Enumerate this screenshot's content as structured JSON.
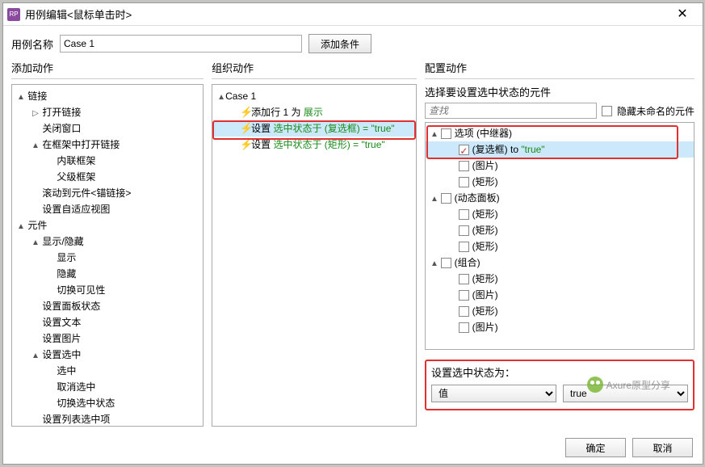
{
  "titlebar": {
    "title": "用例编辑<鼠标单击时>"
  },
  "top": {
    "label": "用例名称",
    "value": "Case 1",
    "addCondition": "添加条件"
  },
  "headers": {
    "left": "添加动作",
    "mid": "组织动作",
    "right": "配置动作"
  },
  "leftTree": [
    {
      "lvl": 0,
      "exp": "▲",
      "text": "链接"
    },
    {
      "lvl": 1,
      "exp": "▷",
      "text": "打开链接"
    },
    {
      "lvl": 1,
      "exp": "",
      "text": "关闭窗口"
    },
    {
      "lvl": 1,
      "exp": "▲",
      "text": "在框架中打开链接"
    },
    {
      "lvl": 2,
      "exp": "",
      "text": "内联框架"
    },
    {
      "lvl": 2,
      "exp": "",
      "text": "父级框架"
    },
    {
      "lvl": 1,
      "exp": "",
      "text": "滚动到元件<锚链接>"
    },
    {
      "lvl": 1,
      "exp": "",
      "text": "设置自适应视图"
    },
    {
      "lvl": 0,
      "exp": "▲",
      "text": "元件"
    },
    {
      "lvl": 1,
      "exp": "▲",
      "text": "显示/隐藏"
    },
    {
      "lvl": 2,
      "exp": "",
      "text": "显示"
    },
    {
      "lvl": 2,
      "exp": "",
      "text": "隐藏"
    },
    {
      "lvl": 2,
      "exp": "",
      "text": "切换可见性"
    },
    {
      "lvl": 1,
      "exp": "",
      "text": "设置面板状态"
    },
    {
      "lvl": 1,
      "exp": "",
      "text": "设置文本"
    },
    {
      "lvl": 1,
      "exp": "",
      "text": "设置图片"
    },
    {
      "lvl": 1,
      "exp": "▲",
      "text": "设置选中"
    },
    {
      "lvl": 2,
      "exp": "",
      "text": "选中"
    },
    {
      "lvl": 2,
      "exp": "",
      "text": "取消选中"
    },
    {
      "lvl": 2,
      "exp": "",
      "text": "切换选中状态"
    },
    {
      "lvl": 1,
      "exp": "",
      "text": "设置列表选中项"
    }
  ],
  "midTree": [
    {
      "lvl": 0,
      "exp": "▲",
      "lightning": false,
      "pre": "Case 1",
      "green": ""
    },
    {
      "lvl": 1,
      "exp": "",
      "lightning": true,
      "pre": "添加行 1 为 ",
      "green": "展示"
    },
    {
      "lvl": 1,
      "exp": "",
      "lightning": true,
      "pre": "设置 ",
      "green": "选中状态于 (复选框) = \"true\"",
      "sel": true
    },
    {
      "lvl": 1,
      "exp": "",
      "lightning": true,
      "pre": "设置 ",
      "green": "选中状态于 (矩形) = \"true\""
    }
  ],
  "right": {
    "prompt": "选择要设置选中状态的元件",
    "searchPlaceholder": "查找",
    "hideUnnamed": "隐藏未命名的元件",
    "items": [
      {
        "lvl": 1,
        "exp": "▲",
        "chk": false,
        "text": "选项 (中继器)"
      },
      {
        "lvl": 2,
        "exp": "",
        "chk": true,
        "text": "(复选框) to ",
        "suffix": "\"true\"",
        "sel": true
      },
      {
        "lvl": 2,
        "exp": "",
        "chk": false,
        "text": "(图片)"
      },
      {
        "lvl": 2,
        "exp": "",
        "chk": false,
        "text": "(矩形)"
      },
      {
        "lvl": 1,
        "exp": "▲",
        "chk": false,
        "text": "(动态面板)"
      },
      {
        "lvl": 2,
        "exp": "",
        "chk": false,
        "text": "(矩形)"
      },
      {
        "lvl": 2,
        "exp": "",
        "chk": false,
        "text": "(矩形)"
      },
      {
        "lvl": 2,
        "exp": "",
        "chk": false,
        "text": "(矩形)"
      },
      {
        "lvl": 1,
        "exp": "▲",
        "chk": false,
        "text": "(组合)"
      },
      {
        "lvl": 2,
        "exp": "",
        "chk": false,
        "text": "(矩形)"
      },
      {
        "lvl": 2,
        "exp": "",
        "chk": false,
        "text": "(图片)"
      },
      {
        "lvl": 2,
        "exp": "",
        "chk": false,
        "text": "(矩形)"
      },
      {
        "lvl": 2,
        "exp": "",
        "chk": false,
        "text": "(图片)"
      }
    ],
    "setLabel": "设置选中状态为：",
    "selType": "值",
    "selValue": "true"
  },
  "footer": {
    "ok": "确定",
    "cancel": "取消"
  },
  "watermark": "Axure原型分享"
}
